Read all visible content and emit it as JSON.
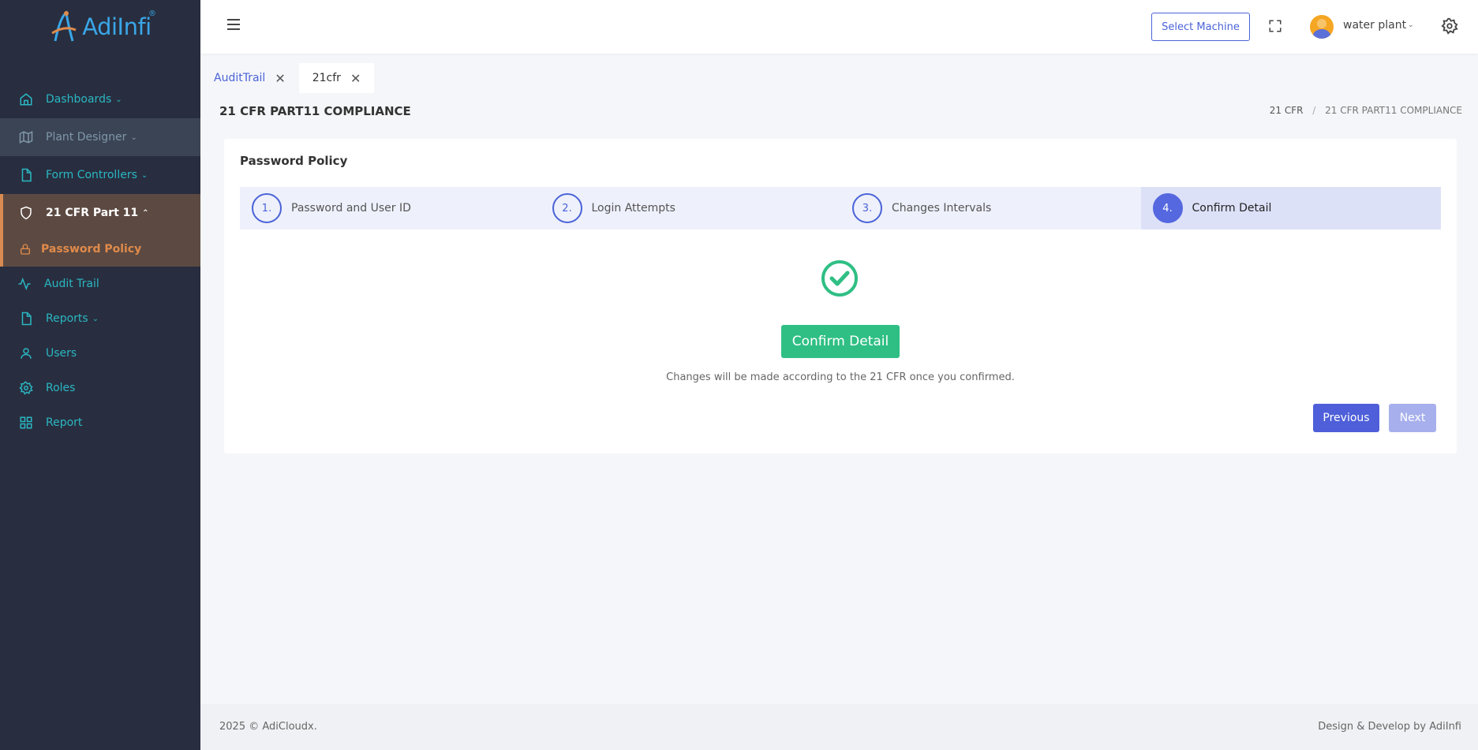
{
  "app": {
    "logo_text": "AdiInfi",
    "logo_reg": "®"
  },
  "sidebar": {
    "items": [
      {
        "label": "Dashboards",
        "icon": "home-icon",
        "chevron": "⌄"
      },
      {
        "label": "Plant Designer",
        "icon": "map-icon",
        "chevron": "⌄"
      },
      {
        "label": "Form Controllers",
        "icon": "file-icon",
        "chevron": "⌄"
      },
      {
        "label": "21 CFR Part 11",
        "icon": "shield-icon",
        "chevron": "⌃"
      },
      {
        "label": "Password Policy",
        "icon": "lock-icon"
      },
      {
        "label": "Audit Trail",
        "icon": "activity-icon"
      },
      {
        "label": "Reports",
        "icon": "file-icon",
        "chevron": "⌄"
      },
      {
        "label": "Users",
        "icon": "user-icon"
      },
      {
        "label": "Roles",
        "icon": "gear-icon"
      },
      {
        "label": "Report",
        "icon": "grid-icon"
      }
    ]
  },
  "header": {
    "select_machine": "Select Machine",
    "user_name": "water plant",
    "user_chevron": "⌄"
  },
  "tabs": [
    {
      "label": "AuditTrail",
      "close": "✕"
    },
    {
      "label": "21cfr",
      "close": "✕"
    }
  ],
  "page": {
    "title": "21 CFR PART11 COMPLIANCE",
    "breadcrumb": [
      "21 CFR",
      "21 CFR PART11 COMPLIANCE"
    ],
    "breadcrumb_sep": "/"
  },
  "card": {
    "title": "Password Policy",
    "steps": [
      {
        "num": "1.",
        "label": "Password and User ID"
      },
      {
        "num": "2.",
        "label": "Login Attempts"
      },
      {
        "num": "3.",
        "label": "Changes Intervals"
      },
      {
        "num": "4.",
        "label": "Confirm Detail"
      }
    ],
    "confirm_button": "Confirm Detail",
    "confirm_note": "Changes will be made according to the 21 CFR once you confirmed.",
    "previous": "Previous",
    "next": "Next"
  },
  "footer": {
    "left": "2025 © AdiCloudx.",
    "right": "Design & Develop by AdiInfi"
  },
  "colors": {
    "sidebar_bg": "#282e3f",
    "accent": "#4a63d8",
    "success": "#2fbf84",
    "sidebar_text": "#2bb7c3",
    "active_orange": "#e08a4a"
  }
}
